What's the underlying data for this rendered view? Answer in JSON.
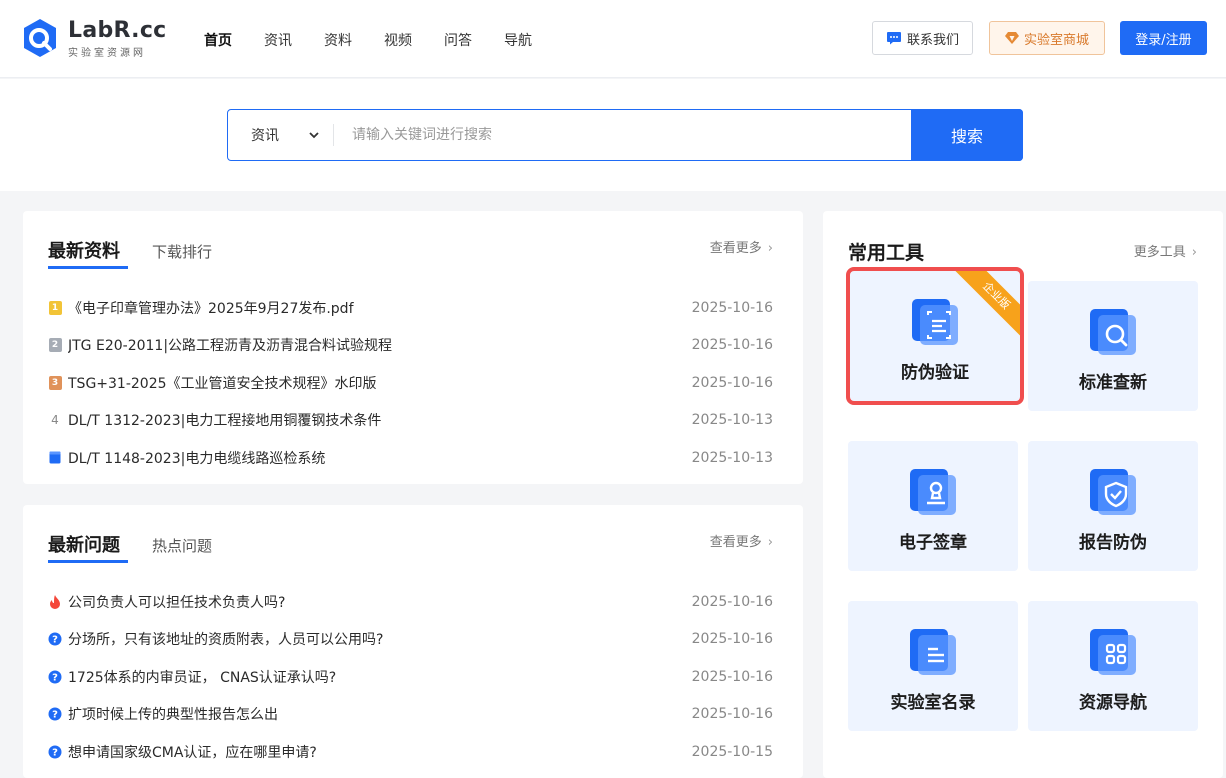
{
  "brand": {
    "name": "LabR.cc",
    "tagline": "实验室资源网",
    "colors": {
      "primary": "#1f6bf5",
      "accent_orange": "#d97a2c",
      "highlight_red": "#f04e4e",
      "ribbon": "#f7a21b"
    }
  },
  "nav": {
    "items": [
      {
        "label": "首页",
        "active": true
      },
      {
        "label": "资讯",
        "active": false
      },
      {
        "label": "资料",
        "active": false
      },
      {
        "label": "视频",
        "active": false
      },
      {
        "label": "问答",
        "active": false
      },
      {
        "label": "导航",
        "active": false
      }
    ]
  },
  "header_actions": {
    "contact_label": "联系我们",
    "contact_icon": "chat-bubble-icon",
    "mall_label": "实验室商城",
    "mall_icon": "diamond-icon",
    "login_label": "登录/注册"
  },
  "search": {
    "category_value": "资讯",
    "placeholder": "请输入关键词进行搜索",
    "button_label": "搜索"
  },
  "latest_docs": {
    "tab_active": "最新资料",
    "tab_other": "下载排行",
    "more_label": "查看更多",
    "items": [
      {
        "rank": "1",
        "icon": "rank-badge-gold",
        "title": "《电子印章管理办法》2025年9月27发布.pdf",
        "date": "2025-10-16"
      },
      {
        "rank": "2",
        "icon": "rank-badge-silver",
        "title": "JTG E20-2011|公路工程沥青及沥青混合料试验规程",
        "date": "2025-10-16"
      },
      {
        "rank": "3",
        "icon": "rank-badge-bronze",
        "title": "TSG+31-2025《工业管道安全技术规程》水印版",
        "date": "2025-10-16"
      },
      {
        "rank": "4",
        "icon": "rank-number",
        "title": "DL/T 1312-2023|电力工程接地用铜覆钢技术条件",
        "date": "2025-10-13"
      },
      {
        "rank": "",
        "icon": "document-icon",
        "title": "DL/T 1148-2023|电力电缆线路巡检系统",
        "date": "2025-10-13"
      }
    ]
  },
  "latest_questions": {
    "tab_active": "最新问题",
    "tab_other": "热点问题",
    "more_label": "查看更多",
    "items": [
      {
        "icon": "fire-icon",
        "title": "公司负责人可以担任技术负责人吗?",
        "date": "2025-10-16"
      },
      {
        "icon": "question-icon",
        "title": "分场所，只有该地址的资质附表，人员可以公用吗?",
        "date": "2025-10-16"
      },
      {
        "icon": "question-icon",
        "title": "1725体系的内审员证， CNAS认证承认吗?",
        "date": "2025-10-16"
      },
      {
        "icon": "question-icon",
        "title": "扩项时候上传的典型性报告怎么出",
        "date": "2025-10-16"
      },
      {
        "icon": "question-icon",
        "title": "想申请国家级CMA认证，应在哪里申请?",
        "date": "2025-10-15"
      }
    ]
  },
  "tools": {
    "title": "常用工具",
    "more_label": "更多工具",
    "items": [
      {
        "label": "防伪验证",
        "icon": "scan-verify-icon",
        "badge": "企业版",
        "highlighted": true
      },
      {
        "label": "标准查新",
        "icon": "magnifier-icon",
        "badge": "",
        "highlighted": false
      },
      {
        "label": "电子签章",
        "icon": "stamp-icon",
        "badge": "",
        "highlighted": false
      },
      {
        "label": "报告防伪",
        "icon": "shield-check-icon",
        "badge": "",
        "highlighted": false
      },
      {
        "label": "实验室名录",
        "icon": "list-book-icon",
        "badge": "",
        "highlighted": false
      },
      {
        "label": "资源导航",
        "icon": "grid-apps-icon",
        "badge": "",
        "highlighted": false
      }
    ]
  }
}
